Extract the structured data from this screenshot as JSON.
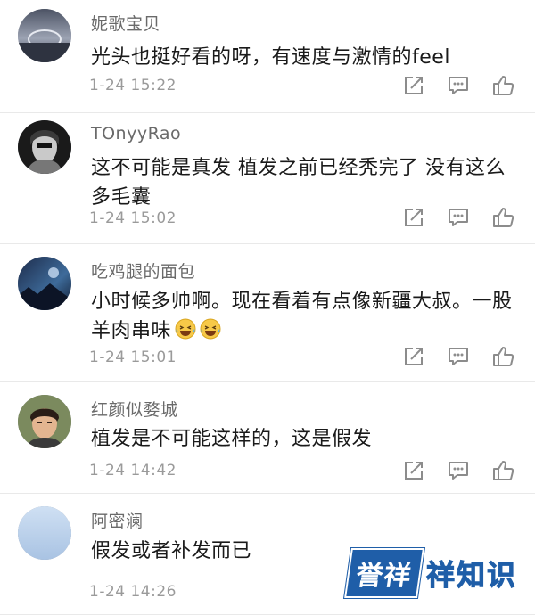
{
  "comments": [
    {
      "username": "妮歌宝贝",
      "text": "光头也挺好看的呀，有速度与激情的feel",
      "time": "1-24 15:22"
    },
    {
      "username": "TOnyyRao",
      "text": "这不可能是真发 植发之前已经秃完了 没有这么多毛囊",
      "time": "1-24 15:02"
    },
    {
      "username": "吃鸡腿的面包",
      "text": "小时候多帅啊。现在看着有点像新疆大叔。一股羊肉串味",
      "time": "1-24 15:01"
    },
    {
      "username": "红颜似婺城",
      "text": "植发是不可能这样的，这是假发",
      "time": "1-24 14:42"
    },
    {
      "username": "阿密澜",
      "text": "假发或者补发而已",
      "time": "1-24 14:26"
    }
  ],
  "icons": {
    "share": "share-icon",
    "reply": "comment-icon",
    "like": "thumbs-up-icon"
  },
  "watermark": {
    "badge": "誉祥",
    "text": "祥知识"
  },
  "colors": {
    "text": "#1a1a1a",
    "meta": "#9a9a9a",
    "username": "#6a6a6a",
    "icon": "#8c8c8c",
    "brand": "#1f5ea8"
  }
}
